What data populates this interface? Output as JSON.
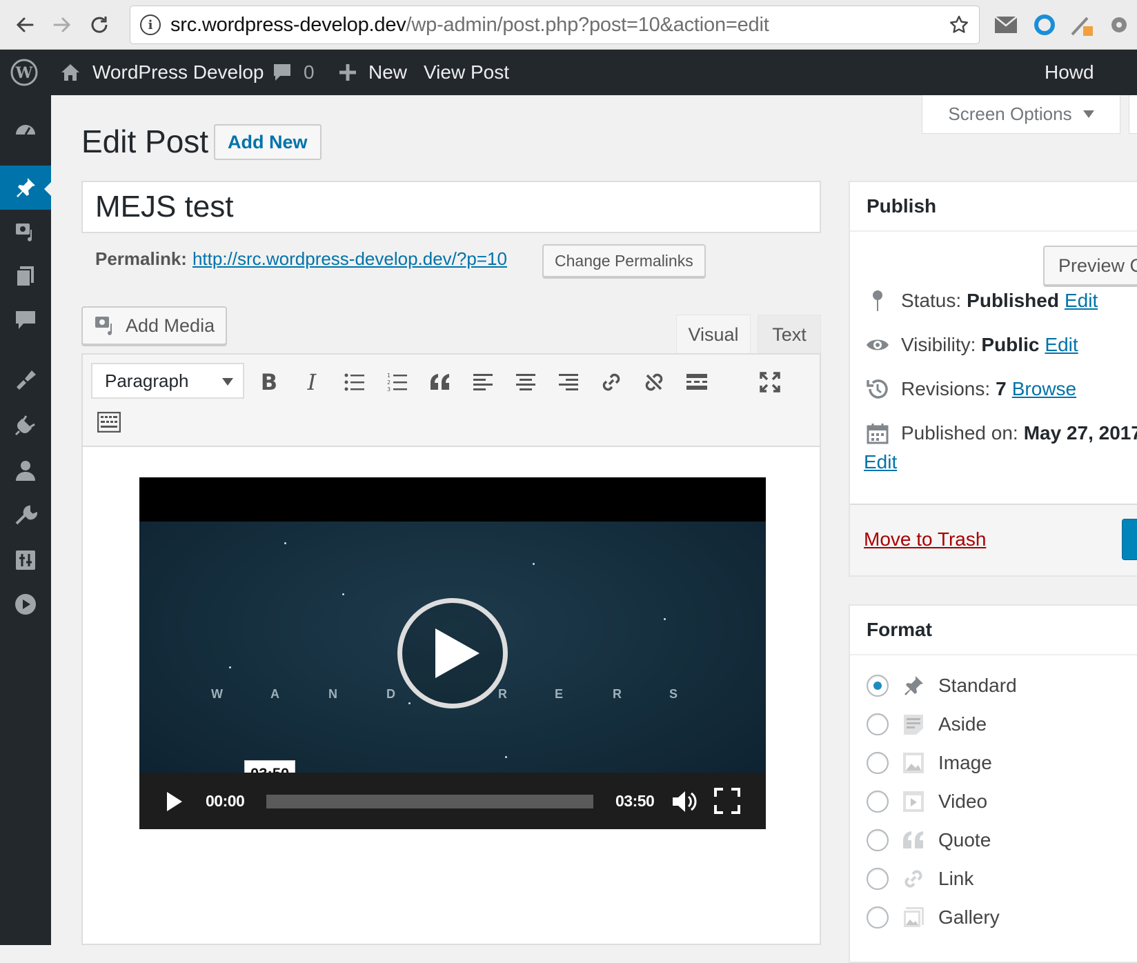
{
  "browser": {
    "url_host": "src.wordpress-develop.dev",
    "url_path": "/wp-admin/post.php?post=10&action=edit"
  },
  "admin_bar": {
    "site_name": "WordPress Develop",
    "comments_count": "0",
    "new_label": "New",
    "view_post_label": "View Post",
    "howdy_label": "Howd"
  },
  "screen_options_label": "Screen Options",
  "page": {
    "title": "Edit Post",
    "add_new_label": "Add New"
  },
  "post": {
    "title": "MEJS test",
    "permalink_label": "Permalink:",
    "permalink_url": "http://src.wordpress-develop.dev/?p=10",
    "change_permalinks_label": "Change Permalinks"
  },
  "editor": {
    "add_media_label": "Add Media",
    "tabs": [
      "Visual",
      "Text"
    ],
    "active_tab": "Visual",
    "format_select_value": "Paragraph",
    "bold_glyph": "B",
    "italic_glyph": "I"
  },
  "video": {
    "title_letters": [
      "W",
      "A",
      "N",
      "D",
      "E",
      "R",
      "E",
      "R",
      "S"
    ],
    "hover_time": "03:50",
    "current_time": "00:00",
    "duration": "03:50",
    "progress_percent": 0
  },
  "publish_box": {
    "heading": "Publish",
    "preview_label": "Preview C",
    "status_label": "Status:",
    "status_value": "Published",
    "visibility_label": "Visibility:",
    "visibility_value": "Public",
    "revisions_label": "Revisions:",
    "revisions_value": "7",
    "browse_label": "Browse",
    "published_on_label": "Published on:",
    "published_on_value": "May 27, 2017",
    "edit_label": "Edit",
    "trash_label": "Move to Trash"
  },
  "format_box": {
    "heading": "Format",
    "options": [
      "Standard",
      "Aside",
      "Image",
      "Video",
      "Quote",
      "Link",
      "Gallery"
    ],
    "selected": "Standard"
  },
  "colors": {
    "admin_dark": "#23282d",
    "accent_blue": "#0073aa",
    "trash_red": "#a00000",
    "primary_button": "#0085ba"
  },
  "icons": {
    "admin_menu": [
      "dashboard-icon",
      "posts-icon",
      "media-icon",
      "pages-icon",
      "comments-icon",
      "appearance-icon",
      "plugins-icon",
      "users-icon",
      "tools-icon",
      "settings-icon",
      "play-circle-icon"
    ]
  }
}
